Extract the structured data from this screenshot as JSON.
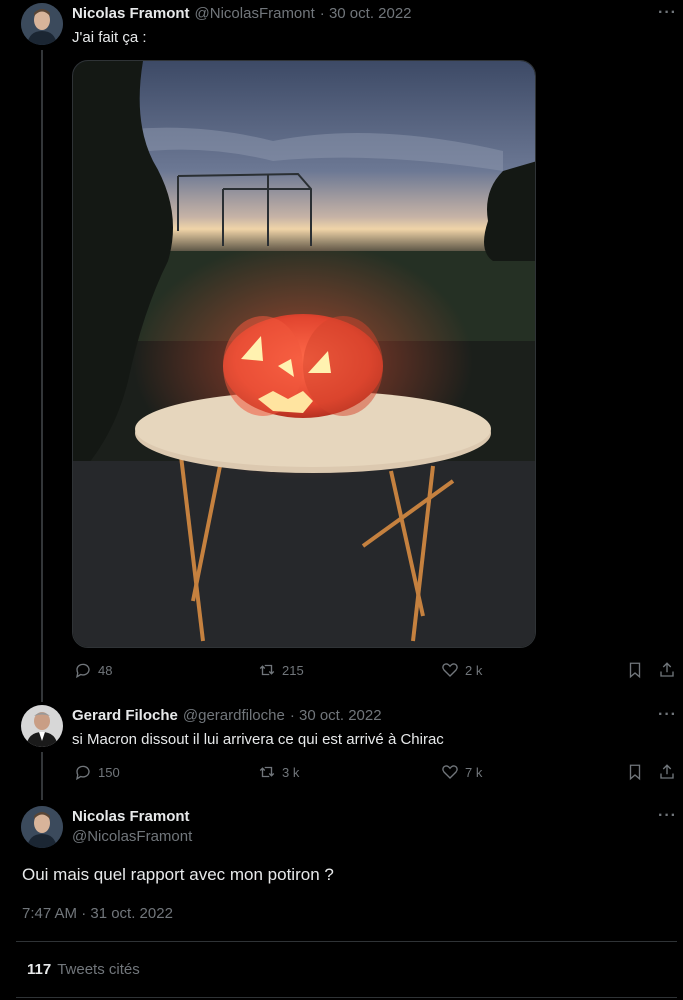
{
  "tweet1": {
    "name": "Nicolas Framont",
    "handle": "@NicolasFramont",
    "date": "· 30 oct. 2022",
    "text": "J'ai fait ça :",
    "replies": "48",
    "retweets": "215",
    "likes": "2 k"
  },
  "tweet2": {
    "name": "Gerard Filoche",
    "handle": "@gerardfiloche",
    "date": "· 30 oct. 2022",
    "text": "si Macron dissout il lui arrivera ce qui est arrivé à Chirac",
    "replies": "150",
    "retweets": "3 k",
    "likes": "7 k"
  },
  "main": {
    "name": "Nicolas Framont",
    "handle": "@NicolasFramont",
    "text": "Oui mais quel rapport avec mon potiron ?",
    "timestamp": "7:47 AM · 31 oct. 2022",
    "quotes_count": "117",
    "quotes_label": "Tweets cités"
  },
  "icons": {
    "reply": "reply-icon",
    "retweet": "retweet-icon",
    "like": "heart-icon",
    "bookmark": "bookmark-icon",
    "share": "share-icon",
    "more": "more-icon"
  },
  "more_glyph": "···"
}
